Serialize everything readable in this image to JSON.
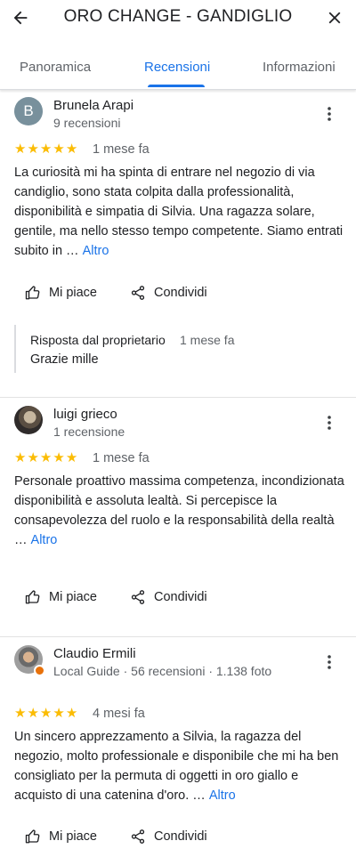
{
  "header": {
    "title": "ORO CHANGE - GANDIGLIO",
    "back_icon": "arrow-back-icon",
    "close_icon": "close-icon"
  },
  "tabs": [
    {
      "label": "Panoramica",
      "selected": false
    },
    {
      "label": "Recensioni",
      "selected": true
    },
    {
      "label": "Informazioni",
      "selected": false
    }
  ],
  "colors": {
    "accent": "#1a73e8",
    "star": "#fbbc04",
    "secondary_text": "#5f6368"
  },
  "reviews": [
    {
      "author": "Brunela Arapi",
      "avatar_letter": "B",
      "meta": "9 recensioni",
      "rating": 5,
      "date": "1 mese fa",
      "text": "La curiosità mi ha spinta di entrare nel negozio di via candiglio, sono stata colpita dalla professionalità, disponibilità e simpatia di Silvia. Una ragazza solare, gentile, ma nello stesso tempo competente. Siamo entrati subito in …",
      "more_label": "Altro",
      "like_label": "Mi piace",
      "share_label": "Condividi",
      "owner_reply": {
        "label": "Risposta dal proprietario",
        "date": "1 mese fa",
        "text": "Grazie mille"
      }
    },
    {
      "author": "luigi grieco",
      "meta": "1 recensione",
      "rating": 5,
      "date": "1 mese fa",
      "text": "Personale proattivo massima competenza, incondizionata disponibilità e assoluta lealtà. Si percepisce la consapevolezza del ruolo e la responsabilità della realtà …",
      "more_label": "Altro",
      "like_label": "Mi piace",
      "share_label": "Condividi"
    },
    {
      "author": "Claudio Ermili",
      "meta": "Local Guide · 56 recensioni · 1.138 foto",
      "rating": 5,
      "date": "4 mesi fa",
      "text": "Un sincero apprezzamento a Silvia, la ragazza del negozio, molto professionale e disponibile che mi ha ben consigliato per la permuta di oggetti in oro giallo e acquisto di una catenina d'oro. …",
      "more_label": "Altro",
      "like_label": "Mi piace",
      "share_label": "Condividi"
    }
  ]
}
